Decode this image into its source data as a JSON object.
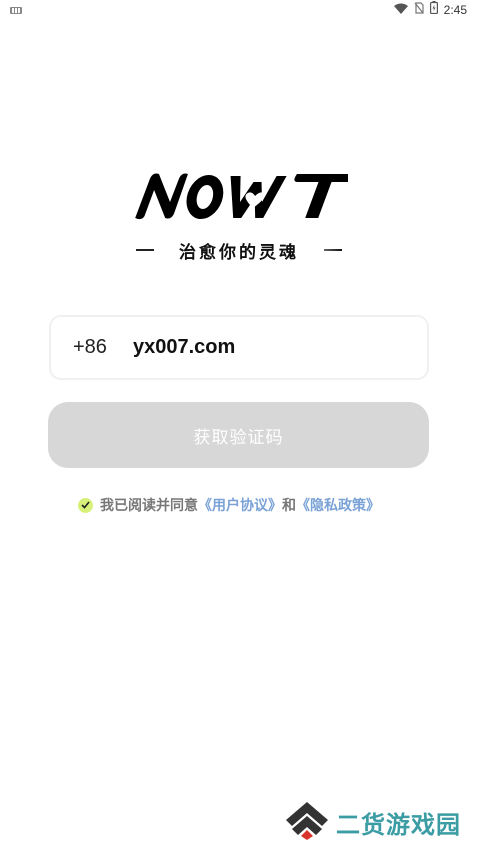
{
  "status_bar": {
    "time": "2:45",
    "icons": [
      "keyboard-icon",
      "wifi-icon",
      "no-sim-icon",
      "battery-charging-icon"
    ]
  },
  "brand": {
    "logo_text": "NOWT",
    "slogan": "治愈你的灵魂"
  },
  "login": {
    "country_code": "+86",
    "phone_value": "yx007.com",
    "get_code_label": "获取验证码"
  },
  "agreement": {
    "checked": true,
    "prefix": "我已阅读并同意",
    "user_agreement": "《用户协议》",
    "conjunction": "和",
    "privacy_policy": "《隐私政策》"
  },
  "watermark": {
    "text": "二货游戏园"
  },
  "colors": {
    "button_disabled": "#d7d7d7",
    "link": "#7aa2d6",
    "check": "#d6f07a",
    "watermark": "#3b9ca3"
  }
}
